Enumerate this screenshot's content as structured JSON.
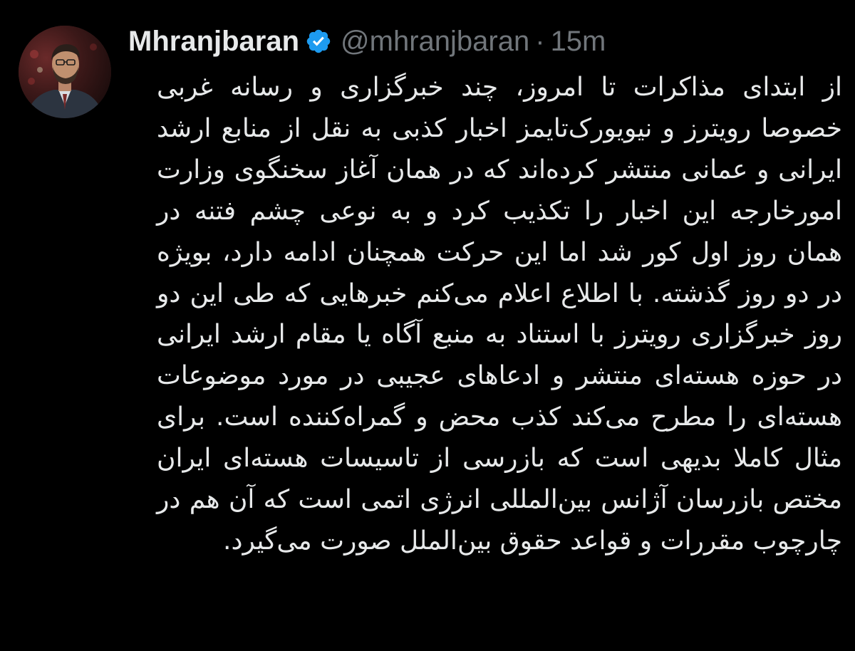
{
  "tweet": {
    "display_name": "Mhranjbaran",
    "handle": "@mhranjbaran",
    "separator": "·",
    "time": "15m",
    "text": "از ابتدای مذاکرات تا امروز، چند خبرگزاری و رسانه غربی خصوصا رویترز و نیویورک‌تایمز اخبار کذبی به نقل از منابع ارشد ایرانی و عمانی منتشر کرده‌اند که در همان آغاز سخنگوی وزارت امورخارجه این اخبار را تکذیب کرد و به نوعی چشم فتنه در همان روز اول کور شد اما این حرکت همچنان ادامه دارد، بویژه در دو روز گذشته. با اطلاع اعلام می‌کنم خبرهایی که طی این دو روز خبرگزاری رویترز با استناد به منبع آگاه یا مقام ارشد ایرانی در حوزه هسته‌ای منتشر و ادعاهای عجیبی در مورد موضوعات هسته‌ای را مطرح می‌کند کذب محض و گمراه‌کننده است. برای مثال کاملا بدیهی است که بازرسی از تاسیسات هسته‌ای ایران مختص بازرسان آژانس بین‌المللی انرژی اتمی است که آن هم در چارچوب مقررات و قواعد حقوق بین‌الملل صورت می‌گیرد."
  },
  "icons": {
    "verified": "verified-badge-icon",
    "avatar": "avatar"
  },
  "colors": {
    "background": "#000000",
    "text_primary": "#e7e9ea",
    "text_secondary": "#71767b",
    "verified_blue": "#1d9bf0"
  }
}
